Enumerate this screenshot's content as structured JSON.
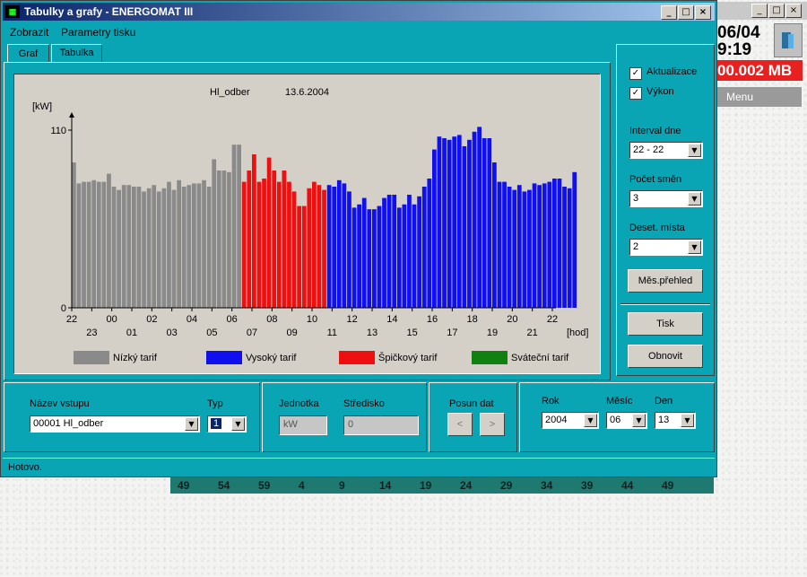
{
  "background_app": {
    "date": "06/04",
    "time": "9:19",
    "disk_usage": "00.002 MB",
    "menu_label": "Menu",
    "ruler_numbers": [
      "49",
      "54",
      "59",
      "4",
      "9",
      "14",
      "19",
      "24",
      "29",
      "34",
      "39",
      "44",
      "49"
    ]
  },
  "window": {
    "title": "Tabulky a grafy - ENERGOMAT III",
    "menu": [
      "Zobrazit",
      "Parametry tisku"
    ],
    "tabs": [
      "Graf",
      "Tabulka"
    ],
    "status": "Hotovo."
  },
  "chart_data": {
    "type": "bar",
    "title": "Hl_odber",
    "date": "13.6.2004",
    "ylabel": "[kW]",
    "xlabel": "[hod]",
    "ylim": [
      0,
      110
    ],
    "yticks": [
      "110",
      "0"
    ],
    "xticks_top": [
      "22",
      "00",
      "02",
      "04",
      "06",
      "08",
      "10",
      "12",
      "14",
      "16",
      "18",
      "20",
      "22"
    ],
    "xticks_bottom": [
      "23",
      "01",
      "03",
      "05",
      "07",
      "09",
      "11",
      "13",
      "15",
      "17",
      "19",
      "21"
    ],
    "x_range_hours": [
      22,
      46
    ],
    "bin_minutes": 15,
    "tariff_colors": {
      "Nízký tarif": "#8a8a8a",
      "Vysoký tarif": "#1010ee",
      "Špičkový tarif": "#ee1010",
      "Sváteční tarif": "#108010"
    },
    "legend": [
      {
        "name": "Nízký tarif",
        "color": "#8a8a8a"
      },
      {
        "name": "Vysoký tarif",
        "color": "#1010ee"
      },
      {
        "name": "Špičkový tarif",
        "color": "#ee1010"
      },
      {
        "name": "Sváteční tarif",
        "color": "#108010"
      }
    ],
    "series": [
      {
        "name": "Nízký tarif",
        "start_hour": 22,
        "values": [
          90,
          77,
          78,
          78,
          79,
          78,
          78,
          83,
          75,
          73,
          76,
          76,
          75,
          75,
          72,
          74,
          76,
          72,
          74,
          78,
          73,
          79,
          75,
          76,
          77,
          77,
          79,
          75,
          92,
          85,
          85,
          84,
          101,
          101
        ]
      },
      {
        "name": "Špičkový tarif",
        "start_hour": 30.5,
        "values": [
          78,
          85,
          95,
          78,
          80,
          93,
          85,
          78,
          85,
          78,
          72,
          63,
          63,
          74,
          78,
          76,
          73
        ]
      },
      {
        "name": "Vysoký tarif",
        "start_hour": 34.75,
        "values": [
          76,
          75,
          79,
          77,
          72,
          62,
          64,
          68,
          61,
          61,
          63,
          68,
          70,
          70,
          62,
          64,
          70,
          64,
          69,
          75,
          80,
          98,
          106,
          105,
          104,
          106,
          107,
          100,
          104,
          109,
          112,
          105,
          105,
          90,
          78,
          78,
          75,
          73,
          76,
          72,
          73,
          77,
          76,
          77,
          78,
          80,
          80,
          75,
          74,
          84
        ]
      }
    ]
  },
  "right_panel": {
    "aktualizace_label": "Aktualizace",
    "aktualizace_checked": true,
    "vykon_label": "Výkon",
    "vykon_checked": true,
    "interval_label": "Interval dne",
    "interval_value": "22 - 22",
    "pocet_smen_label": "Počet směn",
    "pocet_smen_value": "3",
    "deset_mista_label": "Deset. místa",
    "deset_mista_value": "2",
    "mes_prehled_button": "Měs.přehled",
    "tisk_button": "Tisk",
    "obnovit_button": "Obnovit"
  },
  "bottom": {
    "nazev_label": "Název vstupu",
    "nazev_value": "00001   Hl_odber",
    "typ_label": "Typ",
    "typ_value": "1",
    "jednotka_label": "Jednotka",
    "jednotka_value": "kW",
    "stredisko_label": "Středisko",
    "stredisko_value": "0",
    "posun_label": "Posun dat",
    "prev_button": "<",
    "next_button": ">",
    "rok_label": "Rok",
    "rok_value": "2004",
    "mesic_label": "Měsíc",
    "mesic_value": "06",
    "den_label": "Den",
    "den_value": "13"
  }
}
